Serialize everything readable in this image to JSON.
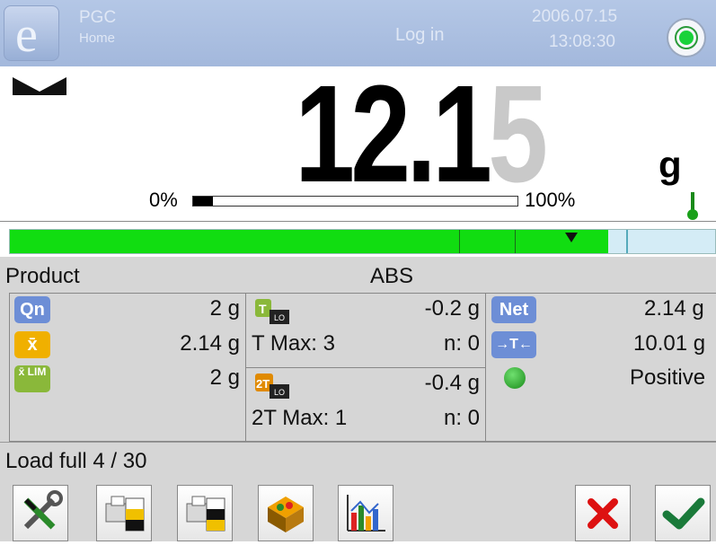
{
  "header": {
    "app_name": "PGC",
    "subtitle": "Home",
    "login_label": "Log in",
    "date": "2006.07.15",
    "time": "13:08:30",
    "logo_letter": "e"
  },
  "display": {
    "weight_main": "12.1",
    "weight_last_digit": "5",
    "unit": "g",
    "bar_min_label": "0%",
    "bar_max_label": "100%",
    "bar_fill_fraction": 0.06
  },
  "info_row": {
    "label": "Product",
    "value": "ABS"
  },
  "stats": {
    "qn_icon": "Qn",
    "qn_value": "2 g",
    "xbar_icon": "x̄",
    "xbar_value": "2.14 g",
    "xlim_icon": "x̄ LIM",
    "xlim_value": "2 g",
    "t_value": "-0.2 g",
    "t_max_label": "T Max: 3",
    "t_n_label": "n: 0",
    "t2_value": "-0.4 g",
    "t2_max_label": "2T Max: 1",
    "t2_n_label": "n: 0",
    "net_icon": "Net",
    "net_value": "2.14 g",
    "tare_icon": "→T←",
    "tare_value": "10.01 g",
    "status_value": "Positive"
  },
  "status_bar": {
    "text": "Load full 4 / 30"
  },
  "colors": {
    "header_bg": "#a9bde0",
    "progress_green": "#11dd11",
    "panel_gray": "#d6d6d6",
    "badge_blue": "#6d8ed6",
    "badge_orange": "#f0b000",
    "badge_green": "#8ab83a"
  }
}
